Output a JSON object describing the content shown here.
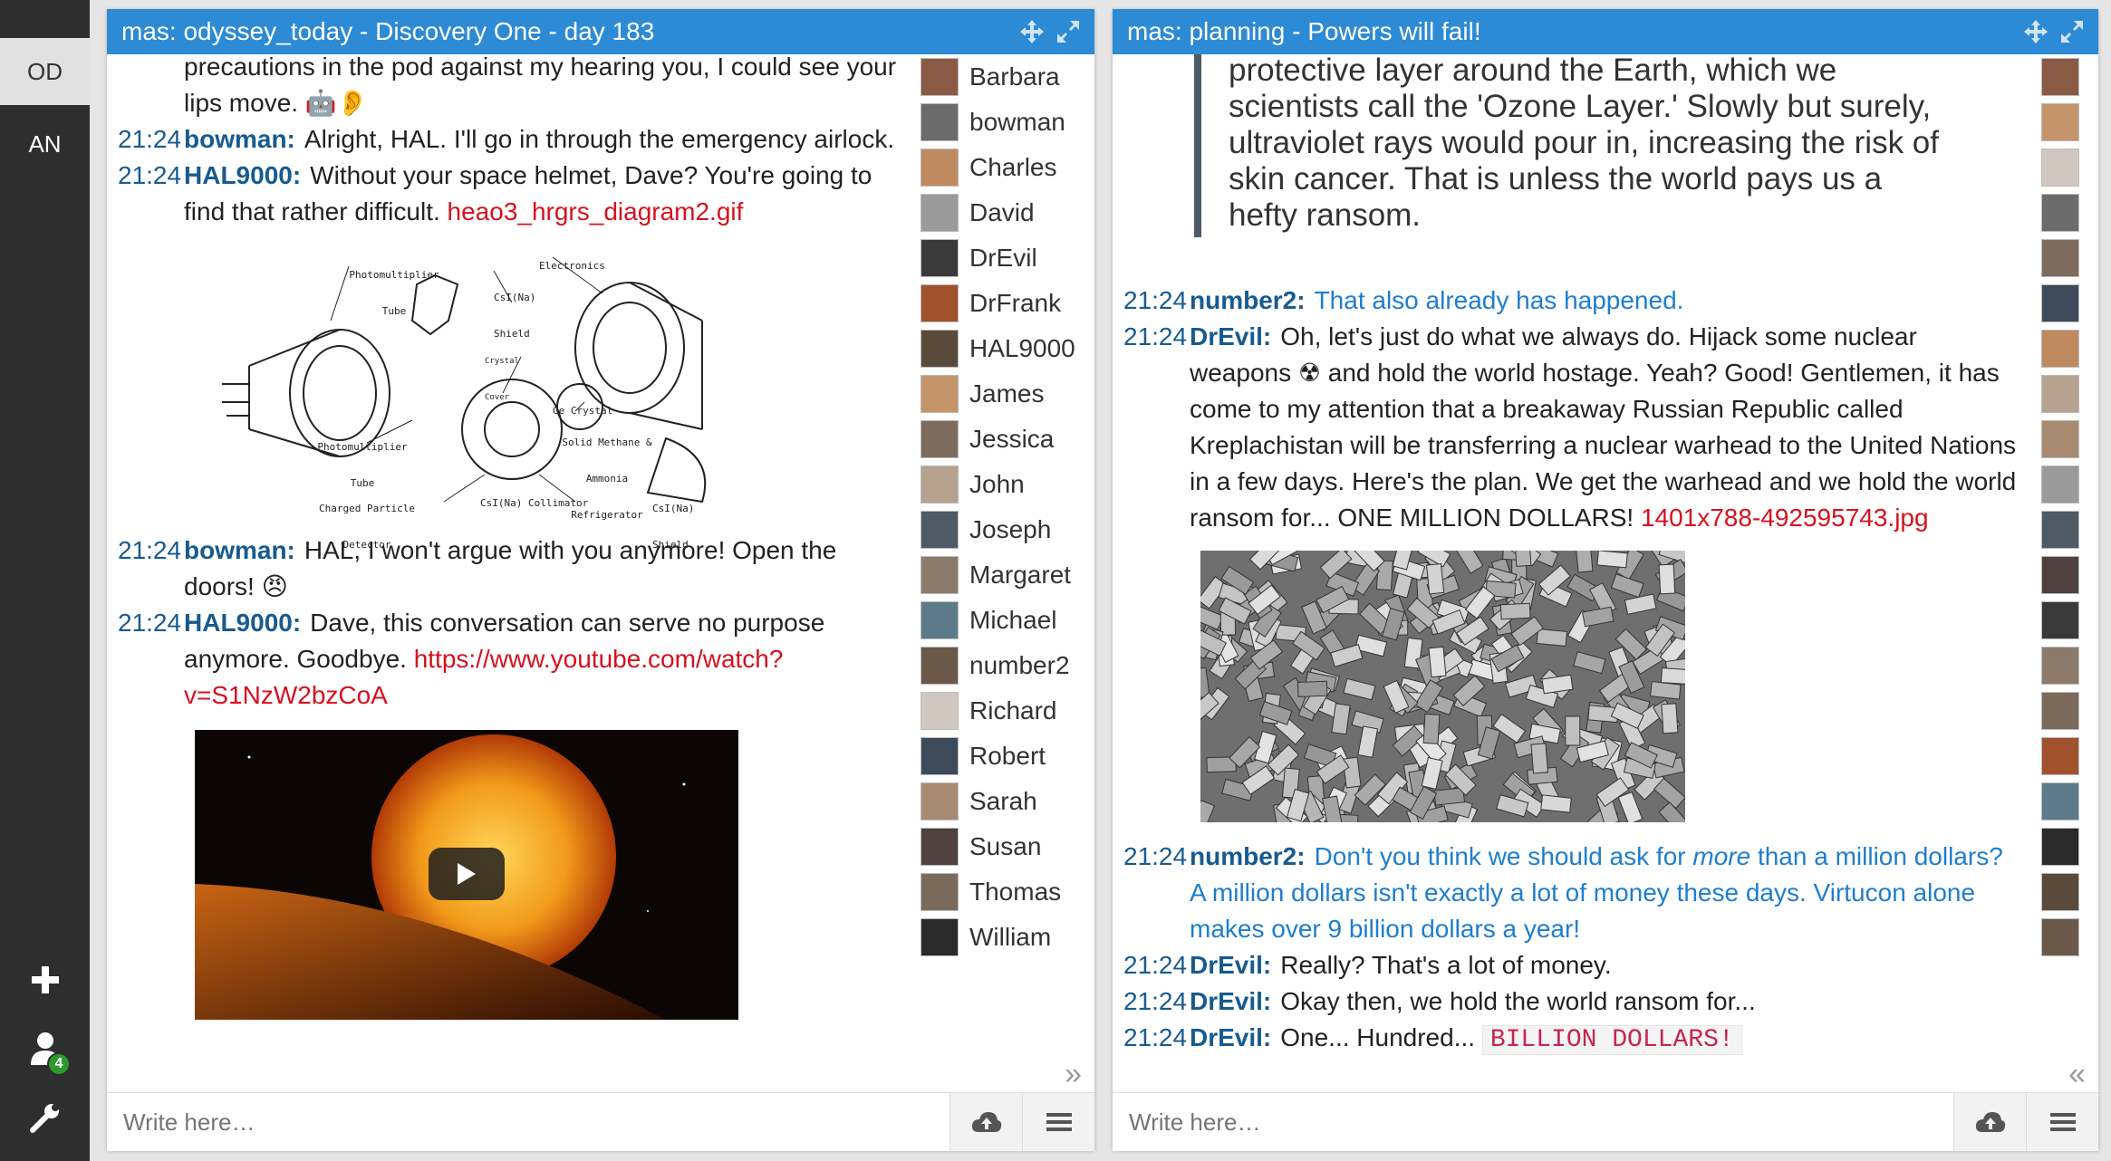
{
  "sidebar": {
    "items": [
      {
        "label": "OD",
        "active": true
      },
      {
        "label": "AN",
        "active": false
      }
    ],
    "add_icon": "plus-icon",
    "contacts_icon": "user-icon",
    "contacts_badge": "4",
    "settings_icon": "wrench-icon"
  },
  "windows": [
    {
      "title": "mas: odyssey_today - Discovery One - day 183",
      "input_placeholder": "Write here…",
      "collapse_glyph": "»",
      "messages": [
        {
          "ts": "",
          "nick": "",
          "text": "precautions in the pod against my hearing you, I could see your lips move. 🤖👂",
          "link": ""
        },
        {
          "ts": "21:24",
          "nick": "bowman:",
          "text": "Alright, HAL. I'll go in through the emergency airlock.",
          "link": ""
        },
        {
          "ts": "21:24",
          "nick": "HAL9000:",
          "text": "Without your space helmet, Dave? You're going to find that rather difficult.",
          "link": "heao3_hrgrs_diagram2.gif"
        },
        {
          "ts": "21:24",
          "nick": "bowman:",
          "text": "HAL, I won't argue with you anymore! Open the doors! 😠",
          "link": ""
        },
        {
          "ts": "21:24",
          "nick": "HAL9000:",
          "text": "Dave, this conversation can serve no purpose anymore. Goodbye.",
          "link": "https://www.youtube.com/watch?v=S1NzW2bzCoA"
        }
      ],
      "diagram_labels": {
        "pmt1": "Photomultiplier Tube",
        "electronics": "Electronics",
        "csi_shield": "CsI(Na) Shield",
        "crystal_cover": "Crystal Cover",
        "ge_crystal": "Ge Crystal",
        "pmt2": "Photomultiplier Tube",
        "refrigerator": "Solid Methane & Ammonia Refrigerator",
        "charged": "Charged Particle Detector",
        "collimator": "CsI(Na) Collimator",
        "csi_shield2": "CsI(Na) Shield"
      },
      "users": [
        "Barbara",
        "bowman",
        "Charles",
        "David",
        "DrEvil",
        "DrFrank",
        "HAL9000",
        "James",
        "Jessica",
        "John",
        "Joseph",
        "Margaret",
        "Michael",
        "number2",
        "Richard",
        "Robert",
        "Sarah",
        "Susan",
        "Thomas",
        "William"
      ]
    },
    {
      "title": "mas: planning - Powers will fail!",
      "input_placeholder": "Write here…",
      "collapse_glyph": "«",
      "quote": "protective layer around the Earth, which we scientists call the 'Ozone Layer.' Slowly but surely, ultraviolet rays would pour in, increasing the risk of skin cancer. That is unless the world pays us a hefty ransom.",
      "messages": [
        {
          "ts": "21:24",
          "nick": "number2:",
          "text": "That also already has happened.",
          "link": ""
        },
        {
          "ts": "21:24",
          "nick": "DrEvil:",
          "text": "Oh, let's just do what we always do. Hijack some nuclear weapons ☢ and hold the world hostage. Yeah? Good! Gentlemen, it has come to my attention that a breakaway Russian Republic called Kreplachistan will be transferring a nuclear warhead to the United Nations in a few days. Here's the plan. We get the warhead and we hold the world ransom for... ONE MILLION DOLLARS!",
          "link": "1401x788-492595743.jpg"
        },
        {
          "ts": "21:24",
          "nick": "number2:",
          "text_pre": "Don't you think we should ask for ",
          "text_em": "more",
          "text_post": " than a million dollars? A million dollars isn't exactly a lot of money these days. Virtucon alone makes over 9 billion dollars a year!"
        },
        {
          "ts": "21:24",
          "nick": "DrEvil:",
          "text": "Really? That's a lot of money."
        },
        {
          "ts": "21:24",
          "nick": "DrEvil:",
          "text": "Okay then, we hold the world ransom for..."
        },
        {
          "ts": "21:24",
          "nick": "DrEvil:",
          "text": "One... Hundred...",
          "code": "BILLION DOLLARS!"
        }
      ]
    }
  ],
  "colors": {
    "titlebar": "#2d8ad5",
    "nick": "#175b8f",
    "link": "#d7111f",
    "highlight": "#1e7ecf",
    "sidebar": "#2e2e2e"
  }
}
